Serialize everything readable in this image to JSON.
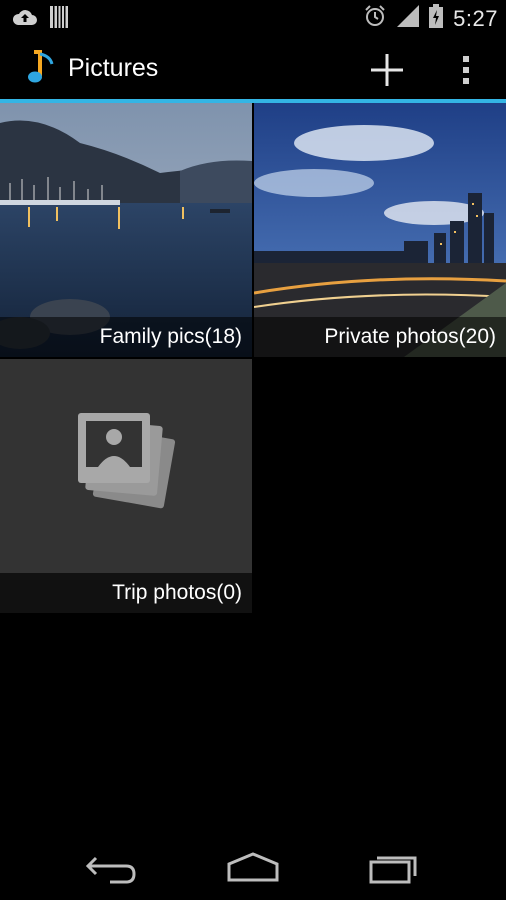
{
  "status_bar": {
    "time": "5:27",
    "icons": [
      "cloud-upload-icon",
      "barcode-icon",
      "alarm-icon",
      "signal-icon",
      "battery-icon"
    ]
  },
  "action_bar": {
    "title": "Pictures",
    "app_icon": "music-note-icon",
    "actions": [
      "add-icon",
      "overflow-menu-icon"
    ],
    "accent_color": "#33b5e5"
  },
  "albums": [
    {
      "label": "Family pics(18)",
      "thumbnail": "harbor-dusk-photo"
    },
    {
      "label": "Private photos(20)",
      "thumbnail": "city-skyline-photo"
    },
    {
      "label": "Trip photos(0)",
      "thumbnail": "empty-album-icon"
    }
  ],
  "nav_bar": {
    "buttons": [
      "back-icon",
      "home-icon",
      "recents-icon"
    ]
  }
}
